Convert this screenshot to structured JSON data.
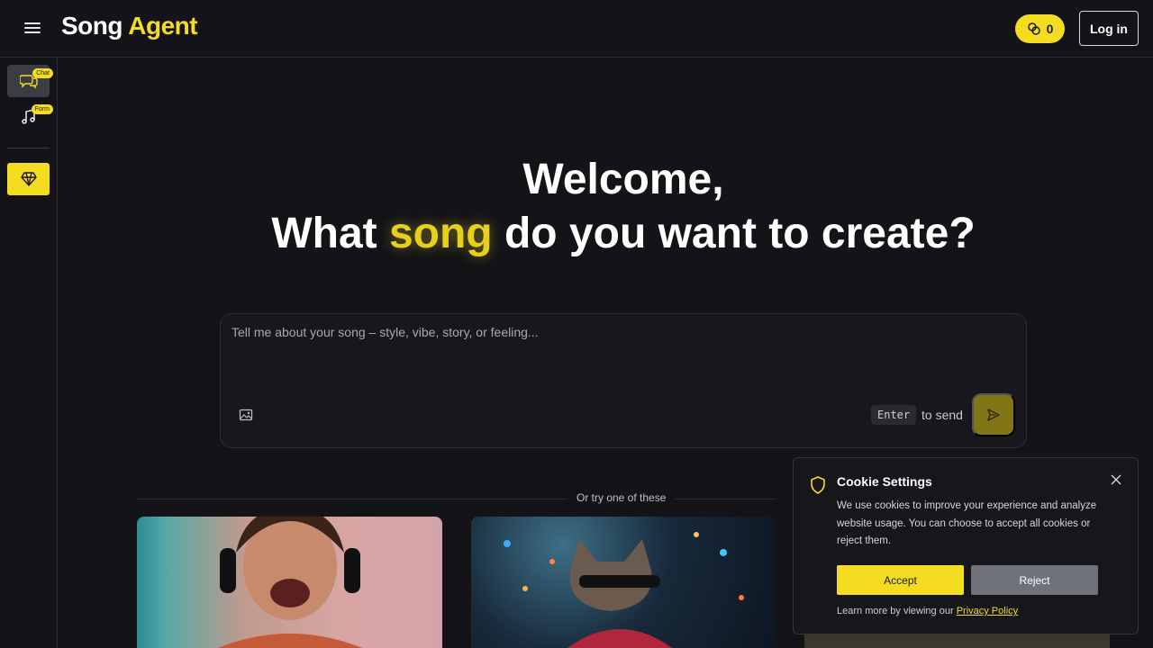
{
  "header": {
    "logo_part1": "Song",
    "logo_part2": "Agent",
    "credits_count": "0",
    "login_label": "Log in",
    "accent_color": "#f4dd21"
  },
  "sidebar": {
    "items": [
      {
        "icon": "chat-bubbles-icon",
        "badge": "Chat",
        "active": true
      },
      {
        "icon": "music-note-icon",
        "badge": "Form",
        "active": false
      }
    ],
    "premium_icon": "diamond-icon"
  },
  "hero": {
    "line1": "Welcome,",
    "line2_before": "What ",
    "line2_highlight": "song",
    "line2_after": " do you want to create?"
  },
  "prompt": {
    "placeholder": "Tell me about your song – style, vibe, story, or feeling...",
    "enter_key": "Enter",
    "enter_hint": "to send"
  },
  "examples": {
    "label": "Or try one of these"
  },
  "cookie": {
    "title": "Cookie Settings",
    "body": "We use cookies to improve your experience and analyze website usage. You can choose to accept all cookies or reject them.",
    "accept_label": "Accept",
    "reject_label": "Reject",
    "footer_text": "Learn more by viewing our ",
    "policy_link": "Privacy Policy"
  }
}
